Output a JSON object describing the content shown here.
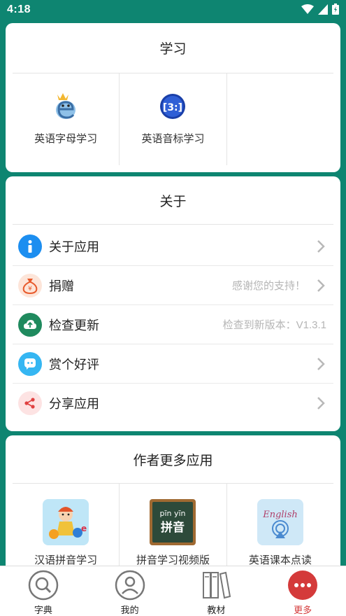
{
  "status_bar": {
    "time": "4:18"
  },
  "learning_card": {
    "title": "学习",
    "items": [
      {
        "label": "英语字母学习",
        "icon": "letter-e-icon"
      },
      {
        "label": "英语音标学习",
        "icon": "phonetic-icon"
      }
    ]
  },
  "about_card": {
    "title": "关于",
    "rows": [
      {
        "label": "关于应用",
        "value": "",
        "icon": "info-icon",
        "color": "#1c8ef0"
      },
      {
        "label": "捐赠",
        "value": "感谢您的支持！",
        "icon": "money-bag-icon",
        "color": "#e85a2c"
      },
      {
        "label": "检查更新",
        "value": "检查到新版本：V1.3.1",
        "icon": "cloud-upload-icon",
        "color": "#1f8a5e"
      },
      {
        "label": "赏个好评",
        "value": "",
        "icon": "chat-bubble-icon",
        "color": "#35b6f2"
      },
      {
        "label": "分享应用",
        "value": "",
        "icon": "share-icon",
        "color": "#e04040"
      }
    ]
  },
  "more_apps_card": {
    "title": "作者更多应用",
    "apps": [
      {
        "label": "汉语拼音学习",
        "icon": "pinyin-cartoon-icon"
      },
      {
        "label": "拼音学习视频版",
        "icon": "chalkboard-icon",
        "board_line1": "pīn yīn",
        "board_line2": "拼音"
      },
      {
        "label": "英语课本点读",
        "icon": "english-book-icon",
        "logo_text": "English"
      }
    ]
  },
  "bottom_nav": {
    "items": [
      {
        "label": "字典",
        "icon": "search-icon"
      },
      {
        "label": "我的",
        "icon": "user-icon"
      },
      {
        "label": "教材",
        "icon": "books-icon"
      },
      {
        "label": "更多",
        "icon": "more-icon"
      }
    ],
    "active": "更多",
    "active_color": "#d43a3a"
  },
  "colors": {
    "background": "#0e8571",
    "card": "#ffffff"
  }
}
